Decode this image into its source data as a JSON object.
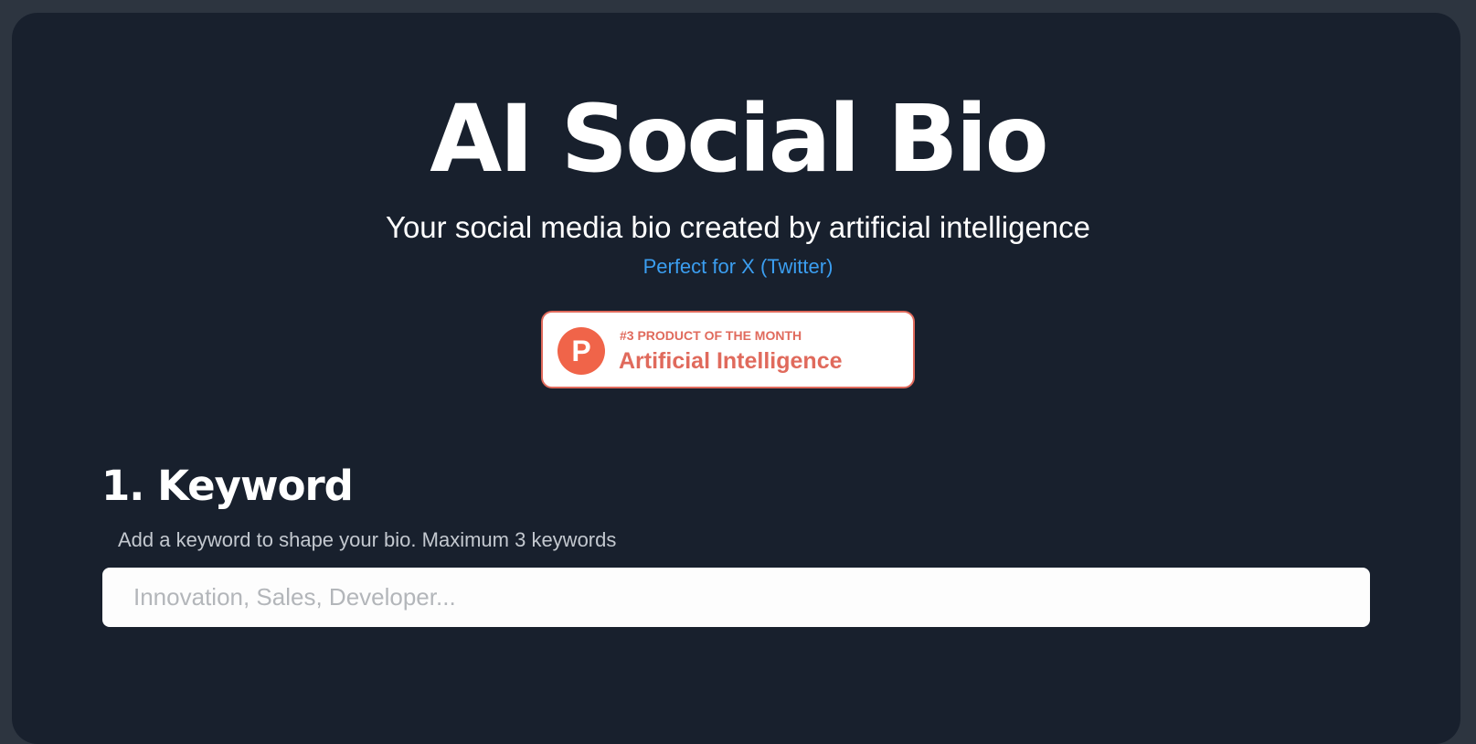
{
  "header": {
    "title": "AI Social Bio",
    "subtitle": "Your social media bio created by artificial intelligence",
    "tagline": "Perfect for X (Twitter)"
  },
  "badge": {
    "logo_letter": "P",
    "kicker": "#3 PRODUCT OF THE MONTH",
    "name": "Artificial Intelligence",
    "accent_color": "#e06a5c"
  },
  "keyword_section": {
    "heading": "1. Keyword",
    "help": "Add a keyword to shape your bio. Maximum 3 keywords",
    "input_value": "",
    "input_placeholder": "Innovation, Sales, Developer..."
  },
  "colors": {
    "page_background": "#2d3540",
    "card_background": "#18202d",
    "link": "#3b9ef0"
  }
}
